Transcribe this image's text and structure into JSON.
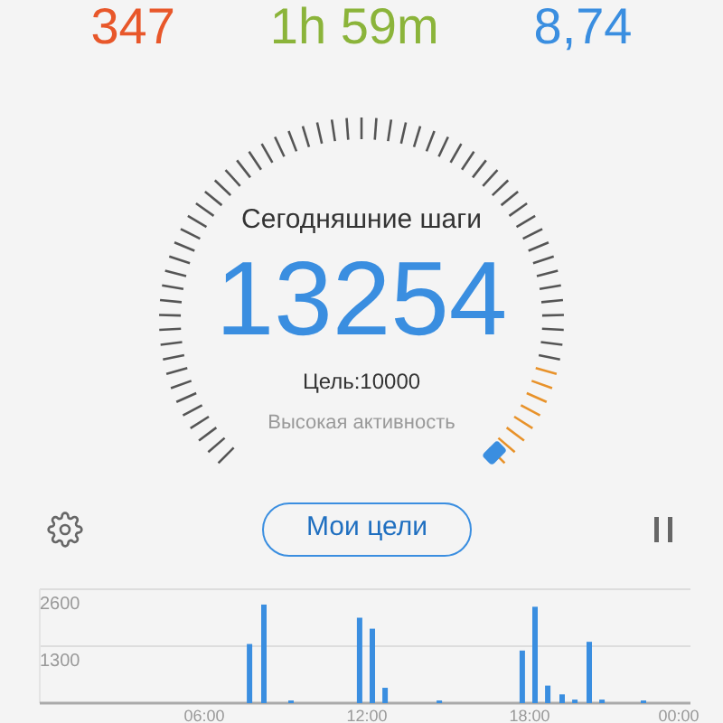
{
  "stats": [
    {
      "value": "347",
      "color": "#e8572a"
    },
    {
      "value": "1h 59m",
      "color": "#8bb43a"
    },
    {
      "value": "8,74",
      "color": "#3a8ee0"
    }
  ],
  "gauge": {
    "title": "Сегодняшние шаги",
    "steps": "13254",
    "goal": "Цель:10000",
    "activity": "Высокая активность"
  },
  "goals_button": "Мои цели",
  "chart_data": {
    "type": "bar",
    "x": [
      7.67,
      8.2,
      9.2,
      11.73,
      12.2,
      12.67,
      14.67,
      17.73,
      18.2,
      18.67,
      19.2,
      19.67,
      20.2,
      20.67,
      22.2
    ],
    "values": [
      1350,
      2250,
      60,
      1950,
      1700,
      350,
      60,
      1200,
      2200,
      400,
      200,
      80,
      1400,
      80,
      60
    ],
    "xlim": [
      0,
      24
    ],
    "ylim": [
      0,
      2600
    ],
    "yticks": [
      1300,
      2600
    ],
    "xticks": [
      {
        "value": 6,
        "label": "06:00"
      },
      {
        "value": 12,
        "label": "12:00"
      },
      {
        "value": 18,
        "label": "18:00"
      },
      {
        "value": 23.5,
        "label": "00:00"
      }
    ]
  }
}
